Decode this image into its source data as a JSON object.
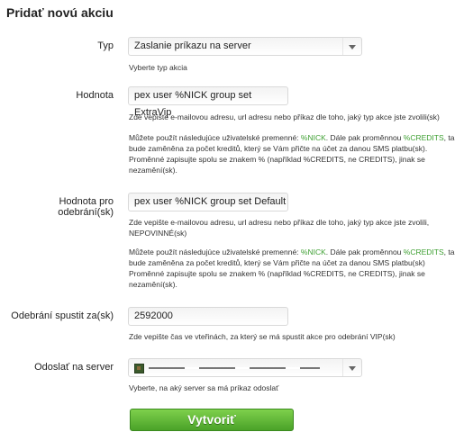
{
  "page": {
    "title": "Pridať novú akciu"
  },
  "typ": {
    "label": "Typ",
    "value": "Zaslanie príkazu na server",
    "help": "Vyberte typ akcia"
  },
  "hodnota": {
    "label": "Hodnota",
    "value": "pex user %NICK group set ExtraVip",
    "help1": "Zde vepište e-mailovou adresu, url adresu nebo příkaz dle toho, jaký typ akce jste zvolili(sk)",
    "help2_a": "Můžete použít následujúce uživatelské premenné: ",
    "var_nick": "%NICK",
    "help2_b": ". Dále pak proměnnou ",
    "var_credits": "%CREDITS",
    "help2_c": ", ta",
    "help2_line2": "bude zaměněna za počet kreditů, který se Vám přičte na účet za danou SMS platbu(sk).",
    "help2_line3": "Proměnné zapisujte spolu se znakem % (například %CREDITS, ne CREDITS), jinak se",
    "help2_line4": "nezamění(sk)."
  },
  "odobrani": {
    "label": "Hodnota pro odebrání(sk)",
    "value": "pex user %NICK group set Default",
    "help1_line1": "Zde vepište e-mailovou adresu, url adresu nebo příkaz dle toho, jaký typ akce jste zvolili,",
    "help1_line2": "NEPOVINNÉ(sk)",
    "help2_a": "Můžete použít následujúce uživatelské premenné: ",
    "var_nick": "%NICK",
    "help2_b": ". Dále pak proměnnou ",
    "var_credits": "%CREDITS",
    "help2_c": ", ta",
    "help2_line2": "bude zaměněna za počet kreditů, který se Vám přičte na účet za danou SMS platbu(sk)",
    "help2_line3": "Proměnné zapisujte spolu se znakem % (například %CREDITS, ne CREDITS), jinak se",
    "help2_line4": "nezamění(sk)."
  },
  "spustit": {
    "label": "Odebrání spustit za(sk)",
    "value": "2592000",
    "help": "Zde vepište čas ve vteřinách, za který se má spustit akce pro odebrání VIP(sk)"
  },
  "server": {
    "label": "Odoslať na server",
    "help": "Vyberte, na aký server sa má príkaz odoslať"
  },
  "submit": {
    "label": "Vytvoriť"
  }
}
